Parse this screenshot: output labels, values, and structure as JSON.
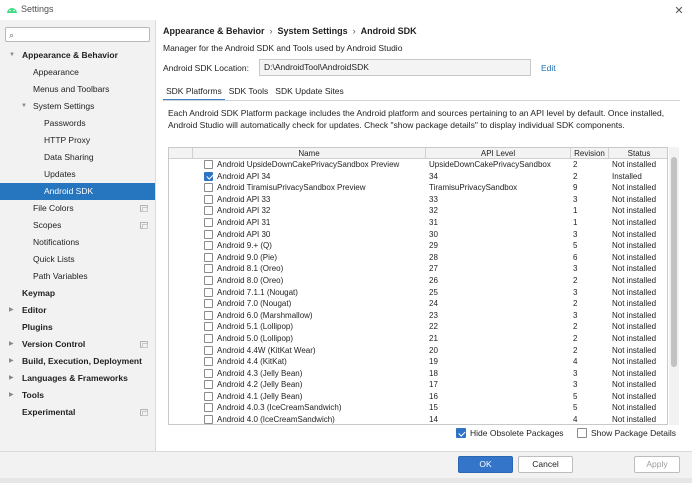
{
  "window": {
    "title": "Settings",
    "close_symbol": "✕"
  },
  "sidebar": {
    "search_placeholder": "",
    "items": [
      {
        "label": "Appearance & Behavior",
        "level": 0,
        "bold": true,
        "expanded": true,
        "arrow": "▼",
        "selected": false,
        "config_icon": false
      },
      {
        "label": "Appearance",
        "level": 1,
        "bold": false,
        "selected": false,
        "config_icon": false
      },
      {
        "label": "Menus and Toolbars",
        "level": 1,
        "bold": false,
        "selected": false,
        "config_icon": false
      },
      {
        "label": "System Settings",
        "level": 1,
        "bold": false,
        "expanded": true,
        "arrow": "▼",
        "selected": false,
        "config_icon": false
      },
      {
        "label": "Passwords",
        "level": 2,
        "bold": false,
        "selected": false,
        "config_icon": false
      },
      {
        "label": "HTTP Proxy",
        "level": 2,
        "bold": false,
        "selected": false,
        "config_icon": false
      },
      {
        "label": "Data Sharing",
        "level": 2,
        "bold": false,
        "selected": false,
        "config_icon": false
      },
      {
        "label": "Updates",
        "level": 2,
        "bold": false,
        "selected": false,
        "config_icon": false
      },
      {
        "label": "Android SDK",
        "level": 2,
        "bold": false,
        "selected": true,
        "config_icon": false
      },
      {
        "label": "File Colors",
        "level": 1,
        "bold": false,
        "selected": false,
        "config_icon": true
      },
      {
        "label": "Scopes",
        "level": 1,
        "bold": false,
        "selected": false,
        "config_icon": true
      },
      {
        "label": "Notifications",
        "level": 1,
        "bold": false,
        "selected": false,
        "config_icon": false
      },
      {
        "label": "Quick Lists",
        "level": 1,
        "bold": false,
        "selected": false,
        "config_icon": false
      },
      {
        "label": "Path Variables",
        "level": 1,
        "bold": false,
        "selected": false,
        "config_icon": false
      },
      {
        "label": "Keymap",
        "level": 0,
        "bold": true,
        "selected": false,
        "config_icon": false
      },
      {
        "label": "Editor",
        "level": 0,
        "bold": true,
        "expanded": false,
        "arrow": "▶",
        "selected": false,
        "config_icon": false
      },
      {
        "label": "Plugins",
        "level": 0,
        "bold": true,
        "selected": false,
        "config_icon": false
      },
      {
        "label": "Version Control",
        "level": 0,
        "bold": true,
        "expanded": false,
        "arrow": "▶",
        "selected": false,
        "config_icon": true
      },
      {
        "label": "Build, Execution, Deployment",
        "level": 0,
        "bold": true,
        "expanded": false,
        "arrow": "▶",
        "selected": false,
        "config_icon": false
      },
      {
        "label": "Languages & Frameworks",
        "level": 0,
        "bold": true,
        "expanded": false,
        "arrow": "▶",
        "selected": false,
        "config_icon": false
      },
      {
        "label": "Tools",
        "level": 0,
        "bold": true,
        "expanded": false,
        "arrow": "▶",
        "selected": false,
        "config_icon": false
      },
      {
        "label": "Experimental",
        "level": 0,
        "bold": true,
        "selected": false,
        "config_icon": true
      }
    ]
  },
  "main": {
    "breadcrumb": [
      "Appearance & Behavior",
      "System Settings",
      "Android SDK"
    ],
    "breadcrumb_separator": "›",
    "description": "Manager for the Android SDK and Tools used by Android Studio",
    "sdk_location_label": "Android SDK Location:",
    "sdk_location_value": "D:\\AndroidTool\\AndroidSDK",
    "edit_label": "Edit",
    "tabs": [
      {
        "label": "SDK Platforms",
        "active": true
      },
      {
        "label": "SDK Tools",
        "active": false
      },
      {
        "label": "SDK Update Sites",
        "active": false
      }
    ],
    "info_text": "Each Android SDK Platform package includes the Android platform and sources pertaining to an API level by default. Once installed, Android Studio will automatically check for updates. Check \"show package details\" to display individual SDK components.",
    "table": {
      "columns": [
        "Name",
        "API Level",
        "Revision",
        "Status"
      ],
      "rows": [
        {
          "checked": false,
          "name": "Android UpsideDownCakePrivacySandbox Preview",
          "api": "UpsideDownCakePrivacySandbox",
          "revision": "2",
          "status": "Not installed"
        },
        {
          "checked": true,
          "name": "Android API 34",
          "api": "34",
          "revision": "2",
          "status": "Installed"
        },
        {
          "checked": false,
          "name": "Android TiramisuPrivacySandbox Preview",
          "api": "TiramisuPrivacySandbox",
          "revision": "9",
          "status": "Not installed"
        },
        {
          "checked": false,
          "name": "Android API 33",
          "api": "33",
          "revision": "3",
          "status": "Not installed"
        },
        {
          "checked": false,
          "name": "Android API 32",
          "api": "32",
          "revision": "1",
          "status": "Not installed"
        },
        {
          "checked": false,
          "name": "Android API 31",
          "api": "31",
          "revision": "1",
          "status": "Not installed"
        },
        {
          "checked": false,
          "name": "Android API 30",
          "api": "30",
          "revision": "3",
          "status": "Not installed"
        },
        {
          "checked": false,
          "name": "Android 9.+ (Q)",
          "api": "29",
          "revision": "5",
          "status": "Not installed"
        },
        {
          "checked": false,
          "name": "Android 9.0 (Pie)",
          "api": "28",
          "revision": "6",
          "status": "Not installed"
        },
        {
          "checked": false,
          "name": "Android 8.1 (Oreo)",
          "api": "27",
          "revision": "3",
          "status": "Not installed"
        },
        {
          "checked": false,
          "name": "Android 8.0 (Oreo)",
          "api": "26",
          "revision": "2",
          "status": "Not installed"
        },
        {
          "checked": false,
          "name": "Android 7.1.1 (Nougat)",
          "api": "25",
          "revision": "3",
          "status": "Not installed"
        },
        {
          "checked": false,
          "name": "Android 7.0 (Nougat)",
          "api": "24",
          "revision": "2",
          "status": "Not installed"
        },
        {
          "checked": false,
          "name": "Android 6.0 (Marshmallow)",
          "api": "23",
          "revision": "3",
          "status": "Not installed"
        },
        {
          "checked": false,
          "name": "Android 5.1 (Lollipop)",
          "api": "22",
          "revision": "2",
          "status": "Not installed"
        },
        {
          "checked": false,
          "name": "Android 5.0 (Lollipop)",
          "api": "21",
          "revision": "2",
          "status": "Not installed"
        },
        {
          "checked": false,
          "name": "Android 4.4W (KitKat Wear)",
          "api": "20",
          "revision": "2",
          "status": "Not installed"
        },
        {
          "checked": false,
          "name": "Android 4.4 (KitKat)",
          "api": "19",
          "revision": "4",
          "status": "Not installed"
        },
        {
          "checked": false,
          "name": "Android 4.3 (Jelly Bean)",
          "api": "18",
          "revision": "3",
          "status": "Not installed"
        },
        {
          "checked": false,
          "name": "Android 4.2 (Jelly Bean)",
          "api": "17",
          "revision": "3",
          "status": "Not installed"
        },
        {
          "checked": false,
          "name": "Android 4.1 (Jelly Bean)",
          "api": "16",
          "revision": "5",
          "status": "Not installed"
        },
        {
          "checked": false,
          "name": "Android 4.0.3 (IceCreamSandwich)",
          "api": "15",
          "revision": "5",
          "status": "Not installed"
        },
        {
          "checked": false,
          "name": "Android 4.0 (IceCreamSandwich)",
          "api": "14",
          "revision": "4",
          "status": "Not installed"
        }
      ]
    },
    "hide_obsolete": {
      "label": "Hide Obsolete Packages",
      "checked": true
    },
    "show_details": {
      "label": "Show Package Details",
      "checked": false
    }
  },
  "footer": {
    "ok_label": "OK",
    "cancel_label": "Cancel",
    "apply_label": "Apply"
  },
  "colors": {
    "accent": "#2675bf",
    "primary_button": "#3474c9",
    "link": "#2470b3"
  }
}
